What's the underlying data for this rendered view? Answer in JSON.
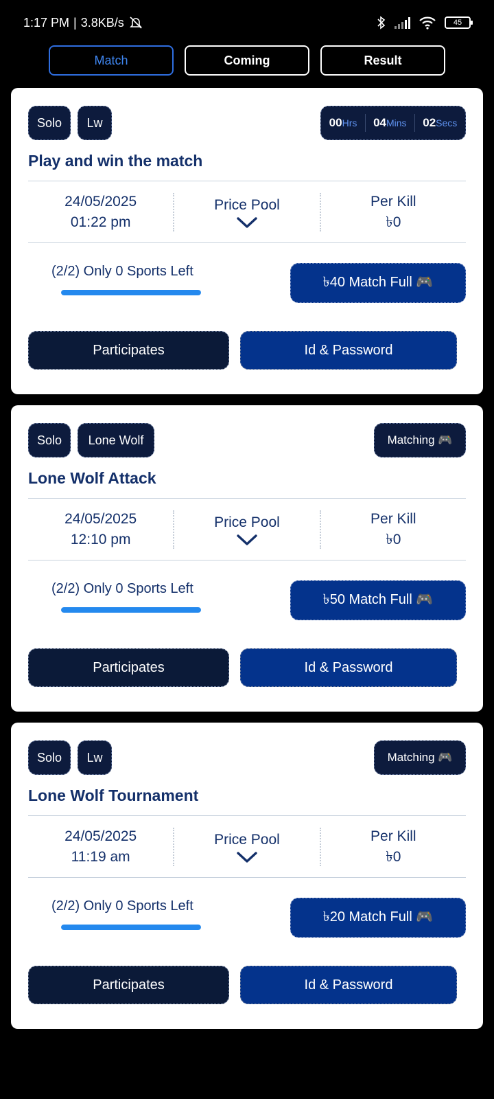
{
  "status_bar": {
    "time": "1:17 PM",
    "speed": "3.8KB/s",
    "battery": "45"
  },
  "tabs": [
    {
      "label": "Match",
      "active": true
    },
    {
      "label": "Coming",
      "active": false
    },
    {
      "label": "Result",
      "active": false
    }
  ],
  "cards": [
    {
      "chips": [
        "Solo",
        "Lw"
      ],
      "timer": {
        "hours": "00",
        "hours_unit": "Hrs",
        "mins": "04",
        "mins_unit": "Mins",
        "secs": "02",
        "secs_unit": "Secs"
      },
      "title": "Play and win the match",
      "date": "24/05/2025",
      "time": "01:22 pm",
      "pool_label": "Price Pool",
      "kill_label": "Per Kill",
      "kill_value": "৳0",
      "slots_text": "(2/2) Only 0 Sports Left",
      "progress": 1.0,
      "entry_text": "৳40  Match Full 🎮",
      "participants_label": "Participates",
      "id_label": "Id & Password"
    },
    {
      "chips": [
        "Solo",
        "Lone Wolf"
      ],
      "status": "Matching 🎮",
      "title": "Lone Wolf Attack",
      "date": "24/05/2025",
      "time": "12:10 pm",
      "pool_label": "Price Pool",
      "kill_label": "Per Kill",
      "kill_value": "৳0",
      "slots_text": "(2/2) Only 0 Sports Left",
      "progress": 1.0,
      "entry_text": "৳50  Match Full 🎮",
      "participants_label": "Participates",
      "id_label": "Id & Password"
    },
    {
      "chips": [
        "Solo",
        "Lw"
      ],
      "status": "Matching 🎮",
      "title": "Lone Wolf Tournament",
      "date": "24/05/2025",
      "time": "11:19 am",
      "pool_label": "Price Pool",
      "kill_label": "Per Kill",
      "kill_value": "৳0",
      "slots_text": "(2/2) Only 0 Sports Left",
      "progress": 1.0,
      "entry_text": "৳20  Match Full 🎮",
      "participants_label": "Participates",
      "id_label": "Id & Password"
    }
  ]
}
